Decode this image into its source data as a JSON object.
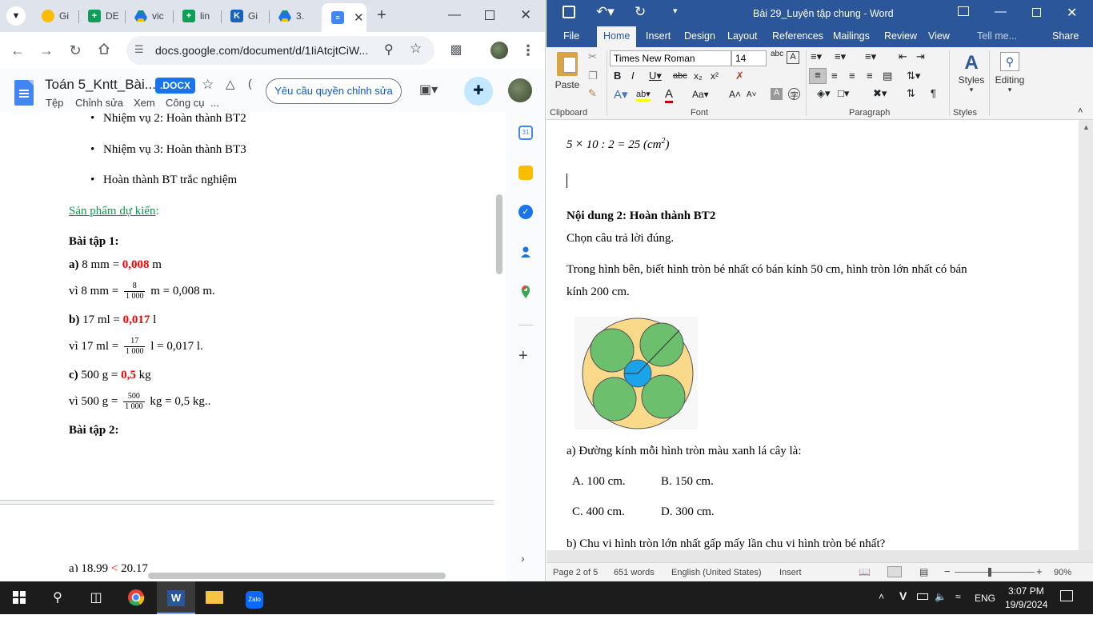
{
  "chrome": {
    "tabs": [
      {
        "label": "Gi",
        "icon": "google-photos-icon",
        "color": "#fbbc04"
      },
      {
        "label": "DE",
        "icon": "google-sheets-icon",
        "color": "#0f9d58"
      },
      {
        "label": "vic",
        "icon": "google-drive-icon",
        "color": "#1a73e8"
      },
      {
        "label": "lin",
        "icon": "google-sheets-icon",
        "color": "#0f9d58"
      },
      {
        "label": "Gi",
        "icon": "k-icon",
        "color": "#1565c0"
      },
      {
        "label": "3.",
        "icon": "google-drive-icon",
        "color": "#1a73e8"
      },
      {
        "label": "",
        "icon": "google-docs-icon",
        "color": "#4285f4"
      }
    ],
    "url": "docs.google.com/document/d/1IiAtcjtCiW...",
    "docs": {
      "title": "Toán 5_Kntt_Bài...",
      "badge": ".DOCX",
      "menu": [
        "Tệp",
        "Chỉnh sửa",
        "Xem",
        "Công cụ",
        "..."
      ],
      "request_edit": "Yêu cầu quyền chỉnh sửa",
      "body": {
        "bullets": [
          "Nhiệm vụ 2: Hoàn thành BT2",
          "Nhiệm vụ 3: Hoàn thành BT3",
          "Hoàn thành BT trắc nghiệm"
        ],
        "product_heading": "Sản phẩm dự kiến",
        "product_colon": ":",
        "ex1_heading": "Bài tập 1:",
        "a_label": "a)",
        "a_q": "8 mm = ",
        "a_ans": "0,008",
        "a_unit": " m",
        "a_why_pre": "vì 8 mm = ",
        "a_num": "8",
        "a_den": "1 000",
        "a_why_post": " m = 0,008 m.",
        "b_label": "b)",
        "b_q": "17 ml = ",
        "b_ans": "0,017",
        "b_unit": " l",
        "b_why_pre": "vì 17 ml = ",
        "b_num": "17",
        "b_den": "1 000",
        "b_why_post": " l = 0,017 l.",
        "c_label": "c)",
        "c_q": "500 g = ",
        "c_ans": "0,5",
        "c_unit": " kg",
        "c_why_pre": "vì 500 g = ",
        "c_num": "500",
        "c_den": "1 000",
        "c_why_post": " kg = 0,5 kg..",
        "ex2_heading": "Bài tập 2:",
        "bottom_line_pre": "a) 18,99 ",
        "bottom_line_sign": "<",
        "bottom_line_post": " 20,17"
      }
    }
  },
  "word": {
    "title": "Bài 29_Luyện tập chung - Word",
    "tabs": [
      "File",
      "Home",
      "Insert",
      "Design",
      "Layout",
      "References",
      "Mailings",
      "Review",
      "View",
      "Tell me...",
      "Share"
    ],
    "font_name": "Times New Roman",
    "font_size": "14",
    "groups": {
      "clipboard": "Clipboard",
      "font": "Font",
      "paragraph": "Paragraph",
      "styles": "Styles",
      "editing": "Editing"
    },
    "paste": "Paste",
    "styles_btn": "Styles",
    "editing_btn": "Editing",
    "doc": {
      "formula_pre": "5 ",
      "formula_times": "×",
      "formula_post": " 10 : 2 = 25 (cm",
      "formula_sup": "2",
      "formula_end": ")",
      "heading": "Nội dung 2: Hoàn thành BT2",
      "instruction": "Chọn câu trả lời đúng.",
      "problem_1": "Trong hình bên, biết hình tròn bé nhất có bán kính 50 cm, hình tròn lớn nhất có bán",
      "problem_2": "kính 200 cm.",
      "qa": "a) Đường kính mỗi hình tròn màu xanh lá cây là:",
      "optA": "A. 100 cm.",
      "optB": "B. 150 cm.",
      "optC": "C. 400 cm.",
      "optD": "D. 300 cm.",
      "qb": "b) Chu vi hình tròn lớn nhất gấp mấy lần chu vi hình tròn bé nhất?"
    },
    "status": {
      "page": "Page 2 of 5",
      "words": "651 words",
      "lang": "English (United States)",
      "mode": "Insert",
      "zoom": "90%"
    }
  },
  "taskbar": {
    "lang": "ENG",
    "time": "3:07 PM",
    "date": "19/9/2024",
    "input": "V"
  }
}
